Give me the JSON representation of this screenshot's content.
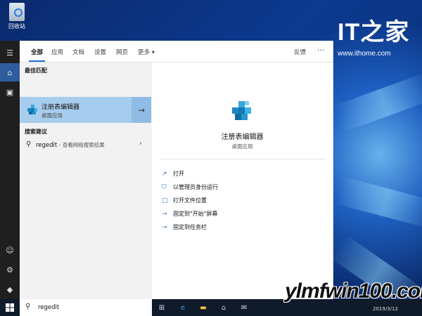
{
  "desktop": {
    "recycle_label": "回收站",
    "brand_logo": "IT之家",
    "brand_url": "www.ithome.com"
  },
  "search": {
    "tabs": [
      "全部",
      "应用",
      "文档",
      "设置",
      "网页",
      "更多 ▾"
    ],
    "feedback": "反馈",
    "more": "···",
    "best_match_label": "最佳匹配",
    "best": {
      "title": "注册表编辑器",
      "subtitle": "桌面应用"
    },
    "suggest_label": "搜索建议",
    "suggestion": {
      "query": "regedit",
      "hint": " - 查看网络搜索结果"
    },
    "detail": {
      "title": "注册表编辑器",
      "subtitle": "桌面应用"
    },
    "actions": [
      "打开",
      "以管理员身份运行",
      "打开文件位置",
      "固定到\"开始\"屏幕",
      "固定到任务栏"
    ],
    "input_value": "regedit"
  },
  "taskbar": {
    "date": "2019/3/12",
    "watermark": "ylmfwin100.com"
  },
  "colors": {
    "accent": "#1f6fd1",
    "selected": "#a7cdee"
  }
}
